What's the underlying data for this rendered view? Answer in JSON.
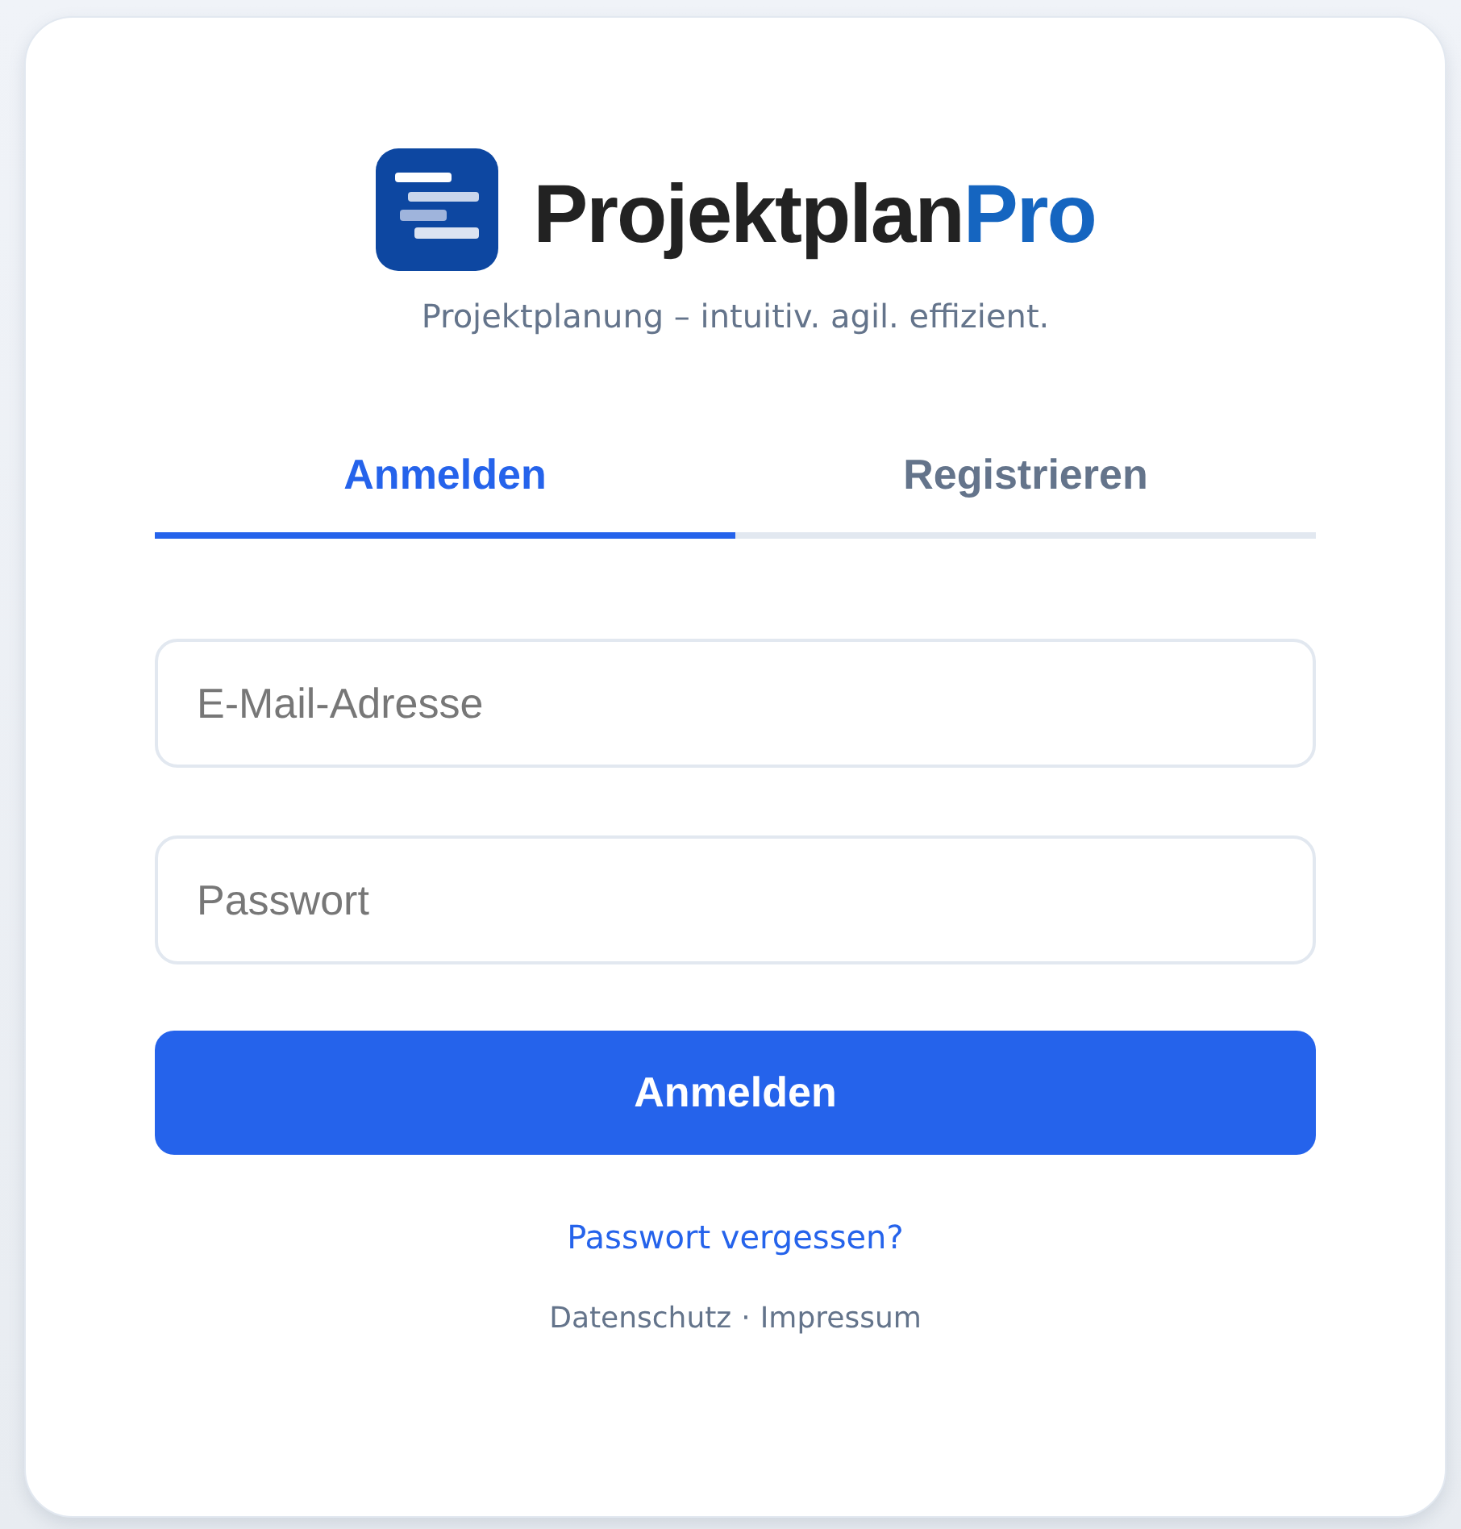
{
  "brand": {
    "name": "Projektplan",
    "accent": "Pro"
  },
  "tagline": "Projektplanung – intuitiv. agil. effizient.",
  "tabs": [
    {
      "label": "Anmelden",
      "selected": true
    },
    {
      "label": "Registrieren",
      "selected": false
    }
  ],
  "fields": [
    {
      "placeholder": "E-Mail-Adresse"
    },
    {
      "placeholder": "Passwort"
    }
  ],
  "submit_button": "Anmelden",
  "forgot_link": "Passwort vergessen?",
  "footer": {
    "links": [
      "Datenschutz",
      "Impressum"
    ],
    "separator": "·"
  }
}
